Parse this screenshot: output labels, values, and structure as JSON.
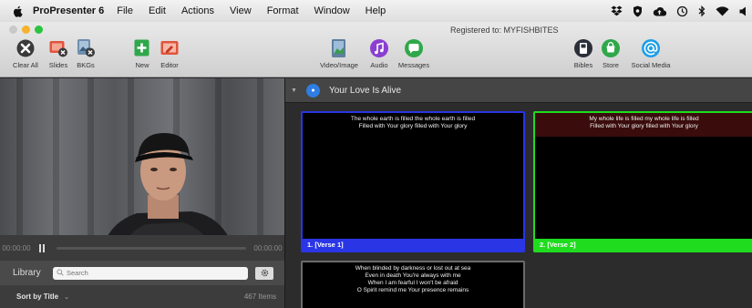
{
  "menubar": {
    "app_name": "ProPresenter 6",
    "items": [
      "File",
      "Edit",
      "Actions",
      "View",
      "Format",
      "Window",
      "Help"
    ]
  },
  "window": {
    "registered_text": "Registered to: MYFISHBITES"
  },
  "toolbar": {
    "clear_all": "Clear All",
    "slides": "Slides",
    "bkgs": "BKGs",
    "new": "New",
    "editor": "Editor",
    "video_image": "Video/Image",
    "audio": "Audio",
    "messages": "Messages",
    "bibles": "Bibles",
    "store": "Store",
    "social_media": "Social Media"
  },
  "transport": {
    "elapsed": "00:00:00",
    "remaining": "00:00:00"
  },
  "library": {
    "title": "Library",
    "search_placeholder": "Search",
    "sort_label": "Sort by Title",
    "item_count": "467 Items"
  },
  "presentation": {
    "title": "Your Love Is Alive",
    "slides": [
      {
        "label": "1. [Verse 1]",
        "color": "#2a35e6",
        "text": "The whole earth is filled the whole earth is filled\nFilled with Your glory filled with Your glory"
      },
      {
        "label": "2. [Verse 2]",
        "color": "#1fdc1f",
        "text": "My whole life is filled my whole life is filled\nFilled with Your glory filled with Your glory"
      },
      {
        "label": "",
        "color": "#6b6b6b",
        "text": "When blinded by darkness or lost out at sea\nEven in death You're always with me\nWhen I am fearful I won't be afraid\nO Spirit remind me Your presence remains"
      }
    ]
  },
  "colors": {
    "verse1": "#2a35e6",
    "verse2": "#1fdc1f",
    "verse2_text_bg": "#3a0c0c",
    "accent_blue": "#2f7de3"
  }
}
